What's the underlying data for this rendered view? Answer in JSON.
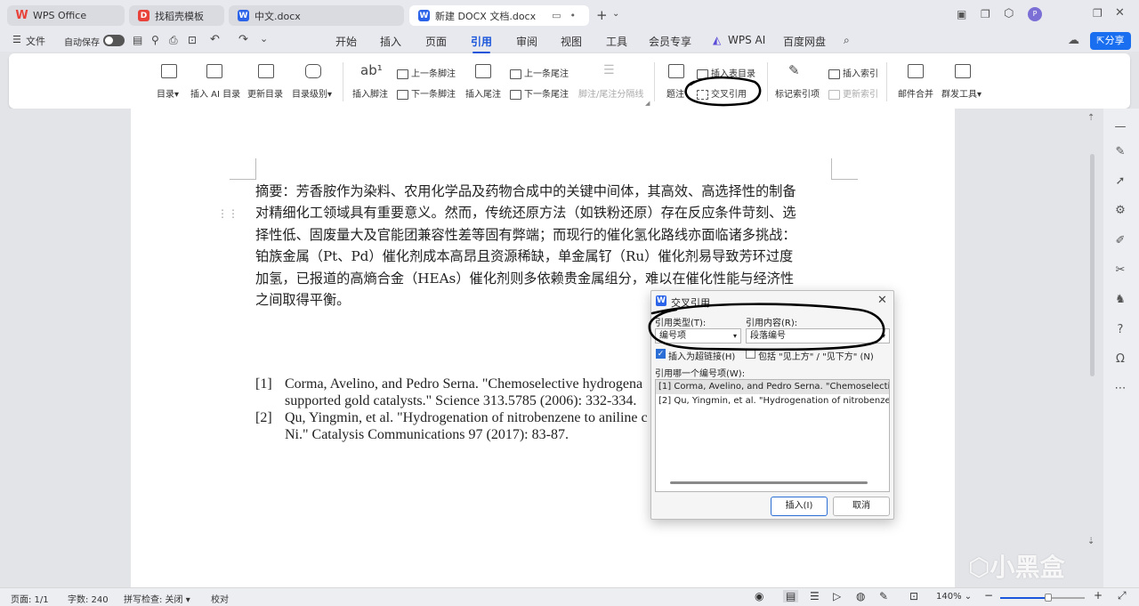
{
  "tabs": [
    {
      "label": "WPS Office",
      "icon": "wps-logo-icon"
    },
    {
      "label": "找稻壳模板",
      "icon": "docer-icon"
    },
    {
      "label": "中文.docx",
      "icon": "word-doc-icon"
    },
    {
      "label": "新建 DOCX 文档.docx",
      "icon": "word-doc-icon"
    }
  ],
  "menubar": {
    "file": "文件",
    "autosave": "自动保存",
    "items": [
      "开始",
      "插入",
      "页面",
      "引用",
      "审阅",
      "视图",
      "工具",
      "会员专享",
      "WPS AI",
      "百度网盘"
    ],
    "share": "分享"
  },
  "ribbon": {
    "toc": "目录",
    "insert_ai_toc": "插入 AI 目录",
    "update_toc": "更新目录",
    "toc_level": "目录级别",
    "insert_footnote": "插入脚注",
    "prev_footnote": "上一条脚注",
    "next_footnote": "下一条脚注",
    "insert_endnote": "插入尾注",
    "prev_endnote": "上一条尾注",
    "next_endnote": "下一条尾注",
    "footnote_separator": "脚注/尾注分隔线",
    "caption": "题注",
    "insert_table_of_figures": "插入表目录",
    "cross_reference": "交叉引用",
    "mark_index": "标记索引项",
    "insert_index": "插入索引",
    "update_index": "更新索引",
    "mail_merge": "邮件合并",
    "mass_send": "群发工具"
  },
  "document": {
    "abstract_lines": [
      "摘要：芳香胺作为染料、农用化学品及药物合成中的关键中间体，其高效、高选择性的制备",
      "对精细化工领域具有重要意义。然而，传统还原方法（如铁粉还原）存在反应条件苛刻、选",
      "择性低、固废量大及官能团兼容性差等固有弊端；而现行的催化氢化路线亦面临诸多挑战：",
      "铂族金属（Pt、Pd）催化剂成本高昂且资源稀缺，单金属钌（Ru）催化剂易导致芳环过度",
      "加氢，已报道的高熵合金（HEAs）催化剂则多依赖贵金属组分，难以在催化性能与经济性",
      "之间取得平衡。"
    ],
    "references": [
      {
        "num": "[1]",
        "line1": "Corma, Avelino, and Pedro Serna. \"Chemoselective hydrogena",
        "line2": "supported gold catalysts.\" Science 313.5785 (2006): 332-334."
      },
      {
        "num": "[2]",
        "line1": "Qu, Yingmin, et al. \"Hydrogenation of nitrobenzene to aniline c",
        "line2": "Ni.\" Catalysis Communications 97 (2017): 83-87."
      }
    ]
  },
  "dialog": {
    "title": "交叉引用",
    "ref_type_label": "引用类型(T):",
    "ref_type_value": "编号项",
    "ref_content_label": "引用内容(R):",
    "ref_content_value": "段落编号",
    "hyperlink_label": "插入为超链接(H)",
    "hyperlink_checked": true,
    "include_label": "包括 \"见上方\" / \"见下方\" (N)",
    "which_label": "引用哪一个编号项(W):",
    "items": [
      "[1] Corma, Avelino, and Pedro Serna. \"Chemoselective",
      "[2] Qu, Yingmin, et al. \"Hydrogenation of nitrobenzen"
    ],
    "insert_button": "插入(I)",
    "cancel_button": "取消"
  },
  "statusbar": {
    "page": "页面: 1/1",
    "words": "字数: 240",
    "spellcheck": "拼写检查: 关闭",
    "proofread": "校对",
    "zoom": "140%"
  },
  "watermark": "小黑盒",
  "colors": {
    "accent": "#1a56db",
    "annotation": "#000000"
  }
}
